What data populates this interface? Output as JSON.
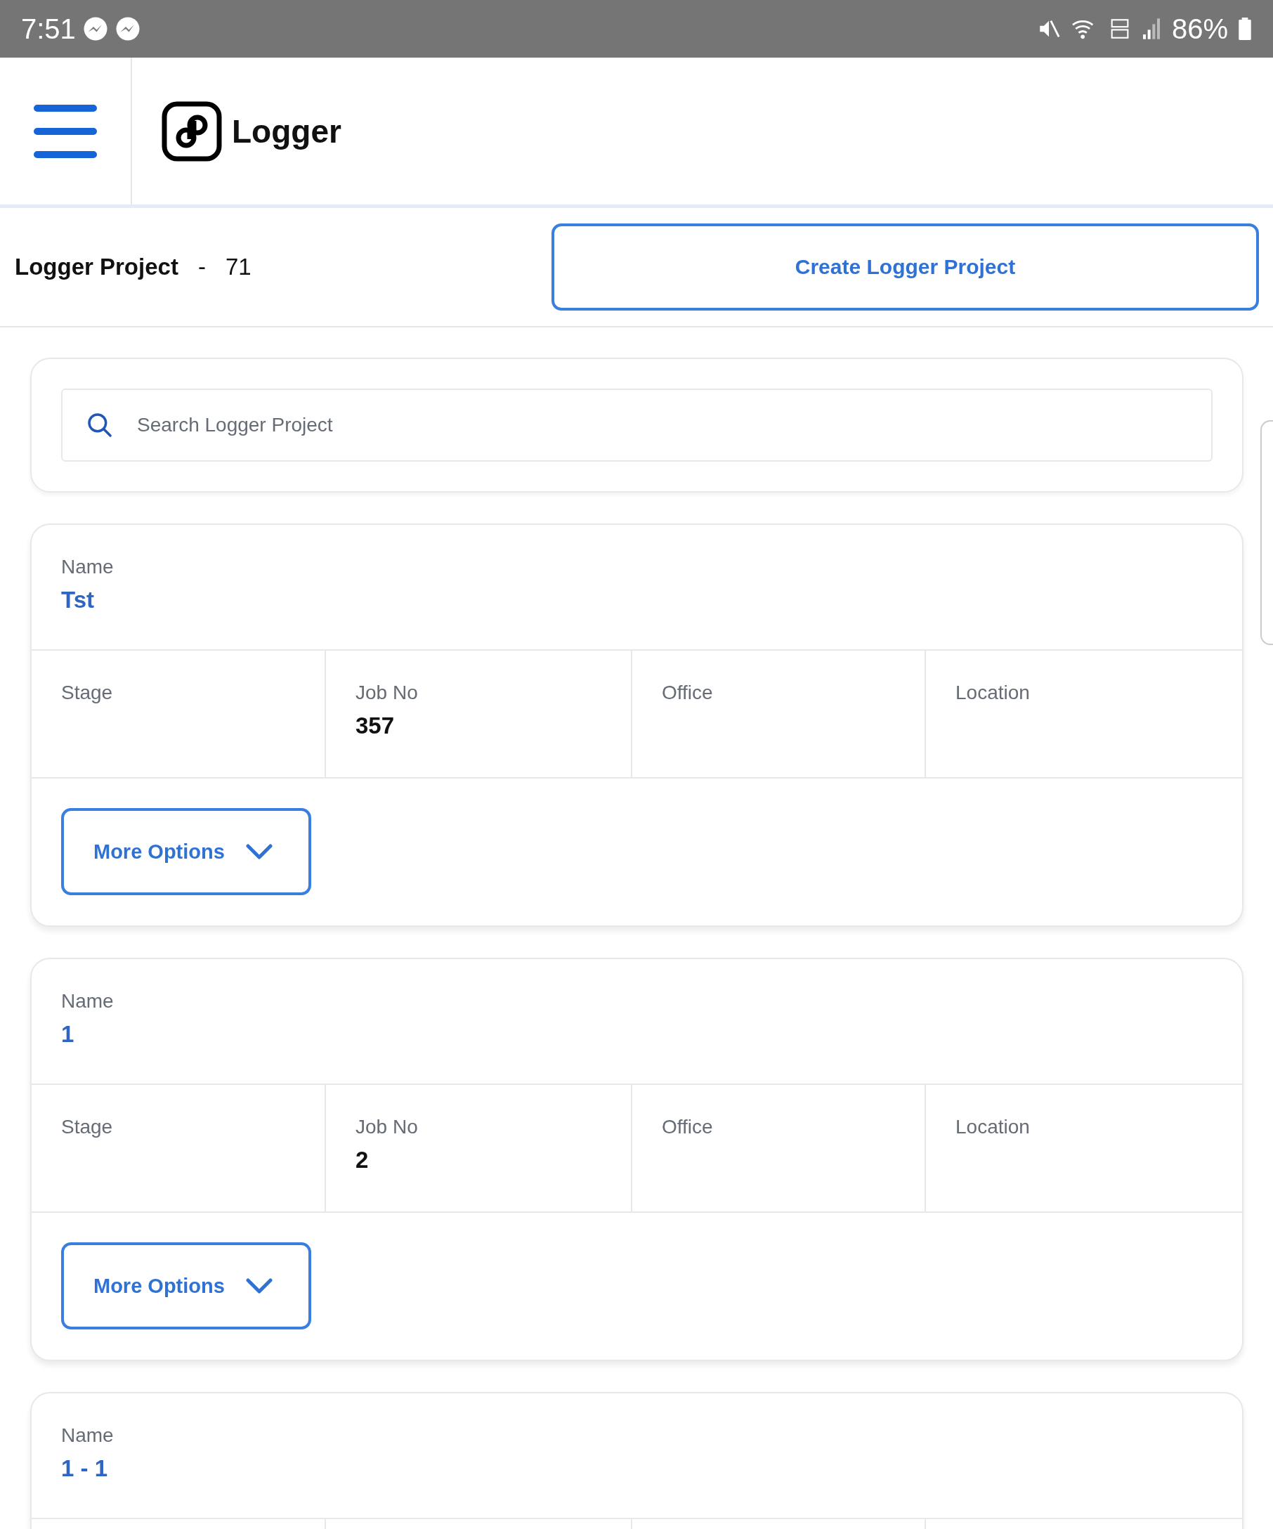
{
  "status_bar": {
    "time": "7:51",
    "battery": "86%"
  },
  "header": {
    "logo_text": "Logger"
  },
  "toolbar": {
    "title": "Logger Project",
    "separator": "-",
    "count": "71",
    "create_button": "Create Logger Project"
  },
  "search": {
    "placeholder": "Search Logger Project"
  },
  "projects": [
    {
      "name_label": "Name",
      "name": "Tst",
      "fields": [
        {
          "label": "Stage"
        },
        {
          "label": "Job No",
          "value": "357"
        },
        {
          "label": "Office"
        },
        {
          "label": "Location"
        }
      ],
      "button": "More Options"
    },
    {
      "name_label": "Name",
      "name": "1",
      "fields": [
        {
          "label": "Stage"
        },
        {
          "label": "Job No",
          "value": "2"
        },
        {
          "label": "Office"
        },
        {
          "label": "Location"
        }
      ],
      "button": "More Options"
    },
    {
      "name_label": "Name",
      "name": "1 - 1"
    }
  ]
}
